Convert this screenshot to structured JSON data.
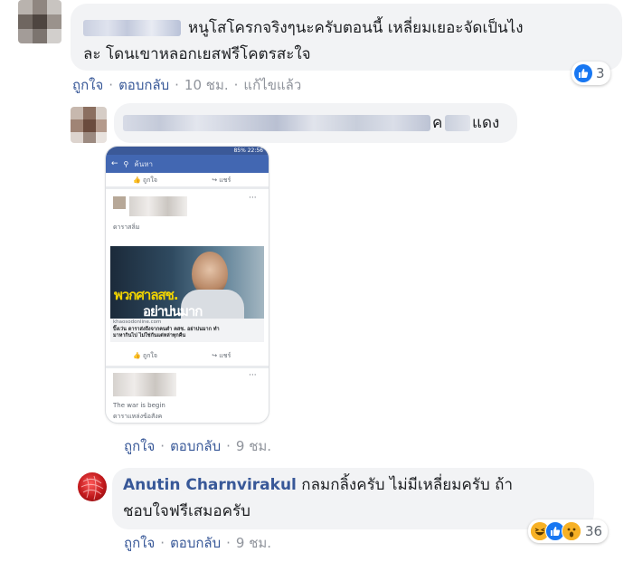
{
  "comments": [
    {
      "text_line1": "หนูโสโครกจริงๆนะครับตอนนี้ เหลี่ยมเยอะจัดเป็นไง",
      "text_line2": "ละ โดนเขาหลอกเยสฟรีโคตรสะใจ",
      "like": "ถูกใจ",
      "reply": "ตอบกลับ",
      "time": "10 ชม.",
      "edited": "แก้ไขแล้ว",
      "reaction_count": "3",
      "reactions": [
        "like"
      ]
    },
    {
      "text_suffix_a": "ค",
      "text_suffix_b": "แดง",
      "like": "ถูกใจ",
      "reply": "ตอบกลับ",
      "time": "9 ชม."
    },
    {
      "author": "Anutin Charnvirakul",
      "text_line1": "กลมกลิ้งครับ ไม่มีเหลี่ยมครับ ถ้า",
      "text_line2": "ชอบใจฟรีเสมอครับ",
      "like": "ถูกใจ",
      "reply": "ตอบกลับ",
      "time": "9 ชม.",
      "reaction_count": "36",
      "reactions": [
        "haha",
        "like",
        "wow"
      ]
    }
  ],
  "phone": {
    "status": "85% 22:56",
    "search_label": "ค้นหา",
    "like_small": "ถูกใจ",
    "share_small": "แชร์",
    "page_name": "ดาราสลิ่ม",
    "headline_1": "พวกศาลสช.",
    "headline_2": "อย่าบ่นมาก",
    "link_domain": "khaosodonline.com",
    "link_text_1": "ปิ๊งเว่น ดาราส่งถึงจากคนดำ คสช. อย่าบ่นมาก ทำ",
    "link_text_2": "มาหากินไป ไม่ใช่กันแต่หล่าทุกคืน",
    "bottom_text_1": "The war is begin",
    "bottom_text_2": "ดาราแหล่งข้อสังค"
  },
  "colors": {
    "link_blue": "#385898",
    "bubble": "#f2f3f5",
    "like_blue": "#1877f2",
    "haha_yellow": "#f7b125"
  }
}
